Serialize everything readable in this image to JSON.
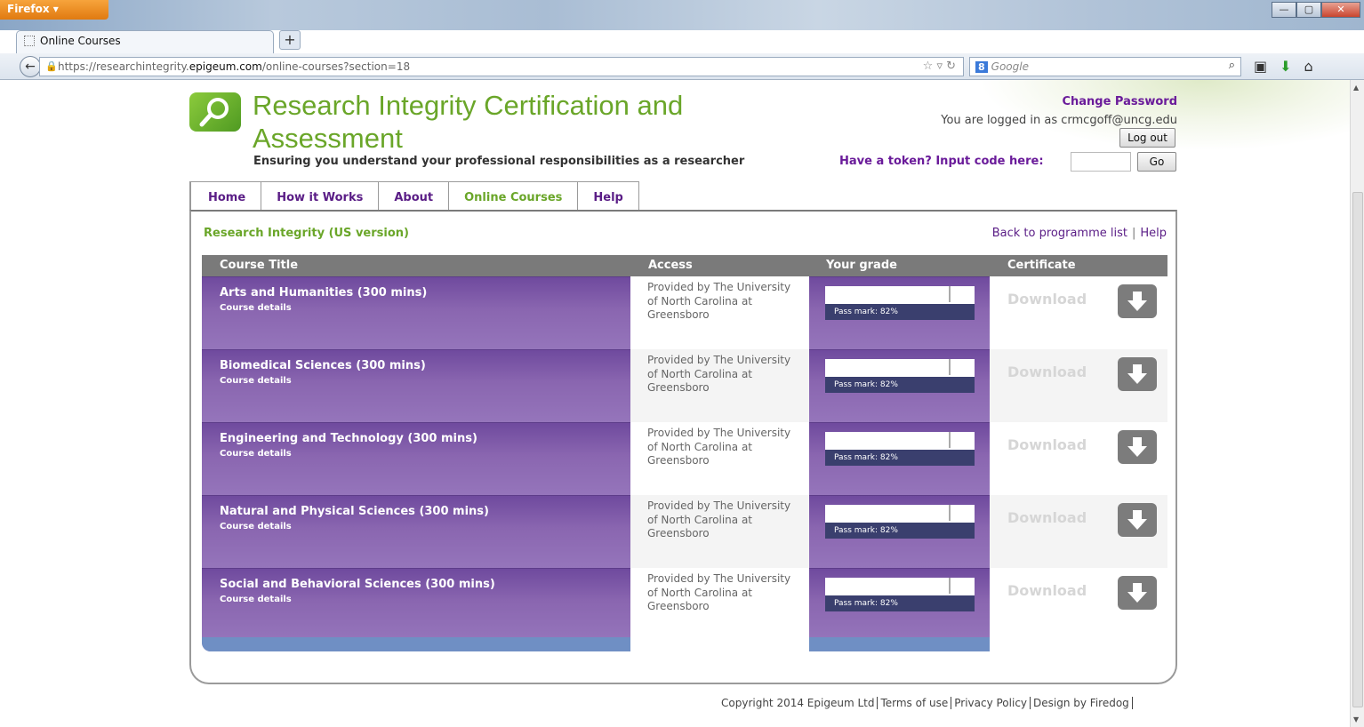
{
  "browser": {
    "menu_button": "Firefox ▾",
    "tab_title": "Online Courses",
    "url_prefix": "https://researchintegrity.",
    "url_domain": "epigeum.com",
    "url_path": "/online-courses?section=18",
    "search_engine": "8",
    "search_placeholder": "Google"
  },
  "header": {
    "site_title": "Research Integrity Certification and Assessment",
    "tagline": "Ensuring you understand your professional responsibilities as a researcher",
    "change_password": "Change Password",
    "logged_in_text": "You are logged in as crmcgoff@uncg.edu",
    "logout": "Log out",
    "token_label": "Have a token? Input code here:",
    "token_value": "",
    "go": "Go"
  },
  "nav": {
    "tabs": [
      "Home",
      "How it Works",
      "About",
      "Online Courses",
      "Help"
    ],
    "active": "Online Courses"
  },
  "programme": {
    "title": "Research Integrity (US version)",
    "back_link": "Back to programme list",
    "sep": "|",
    "help_link": "Help"
  },
  "table": {
    "headers": {
      "course_title": "Course Title",
      "access": "Access",
      "grade": "Your grade",
      "certificate": "Certificate"
    },
    "rows": [
      {
        "title": "Arts and Humanities (300 mins)",
        "details": "Course details",
        "access": "Provided by The University of North Carolina at Greensboro",
        "pass_mark": "Pass mark: 82%",
        "download": "Download"
      },
      {
        "title": "Biomedical Sciences (300 mins)",
        "details": "Course details",
        "access": "Provided by The University of North Carolina at Greensboro",
        "pass_mark": "Pass mark: 82%",
        "download": "Download"
      },
      {
        "title": "Engineering and Technology (300 mins)",
        "details": "Course details",
        "access": "Provided by The University of North Carolina at Greensboro",
        "pass_mark": "Pass mark: 82%",
        "download": "Download"
      },
      {
        "title": "Natural and Physical Sciences (300 mins)",
        "details": "Course details",
        "access": "Provided by The University of North Carolina at Greensboro",
        "pass_mark": "Pass mark: 82%",
        "download": "Download"
      },
      {
        "title": "Social and Behavioral Sciences (300 mins)",
        "details": "Course details",
        "access": "Provided by The University of North Carolina at Greensboro",
        "pass_mark": "Pass mark: 82%",
        "download": "Download"
      }
    ]
  },
  "footer": {
    "copyright": "Copyright 2014 Epigeum Ltd",
    "terms": "Terms of use",
    "privacy": "Privacy Policy",
    "design": "Design by Firedog"
  },
  "colors": {
    "accent_green": "#6aa629",
    "purple": "#8b68b2",
    "link_purple": "#5a1d86"
  }
}
